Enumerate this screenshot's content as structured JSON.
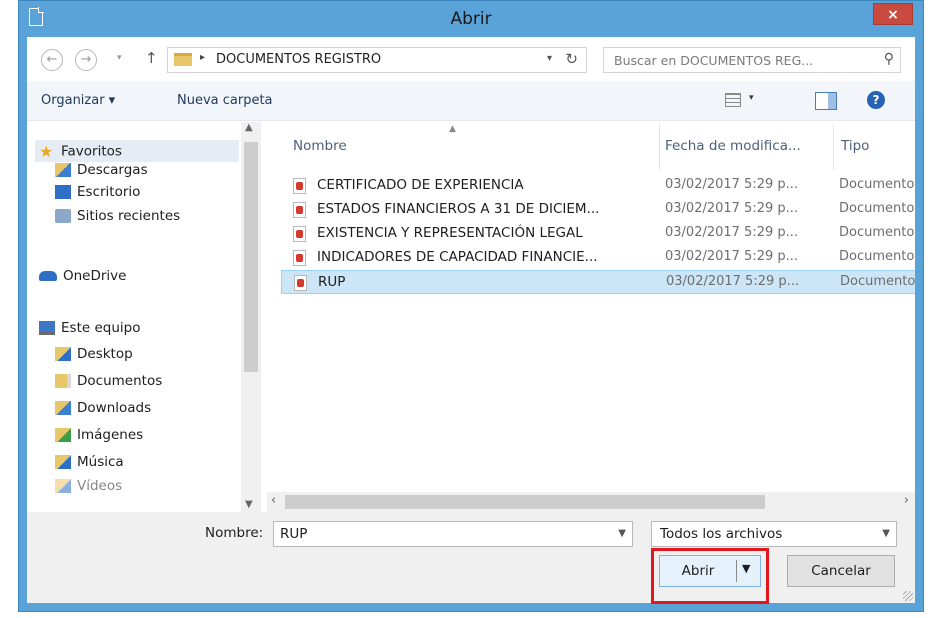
{
  "window": {
    "title": "Abrir",
    "close_label": "×"
  },
  "address": {
    "path": "DOCUMENTOS REGISTRO",
    "search_placeholder": "Buscar en DOCUMENTOS REG...",
    "icons": {
      "back": "back-arrow-icon",
      "forward": "forward-arrow-icon",
      "up": "up-arrow-icon",
      "refresh": "refresh-icon",
      "search": "search-icon"
    }
  },
  "toolbar": {
    "organize_label": "Organizar ▾",
    "new_folder_label": "Nueva carpeta"
  },
  "nav": {
    "favorites": "Favoritos",
    "downloads": "Descargas",
    "desktop_es": "Escritorio",
    "recent": "Sitios recientes",
    "onedrive": "OneDrive",
    "this_pc": "Este equipo",
    "desktop": "Desktop",
    "documents": "Documentos",
    "downloads_en": "Downloads",
    "pictures": "Imágenes",
    "music": "Música",
    "videos": "Vídeos"
  },
  "columns": {
    "name": "Nombre",
    "date": "Fecha de modifica...",
    "type": "Tipo"
  },
  "files": [
    {
      "name": "CERTIFICADO DE EXPERIENCIA",
      "date": "03/02/2017 5:29 p...",
      "type": "Documento"
    },
    {
      "name": "ESTADOS FINANCIEROS A 31 DE DICIEM...",
      "date": "03/02/2017 5:29 p...",
      "type": "Documento"
    },
    {
      "name": "EXISTENCIA Y REPRESENTACIÓN LEGAL",
      "date": "03/02/2017 5:29 p...",
      "type": "Documento"
    },
    {
      "name": "INDICADORES DE CAPACIDAD FINANCIE...",
      "date": "03/02/2017 5:29 p...",
      "type": "Documento"
    },
    {
      "name": "RUP",
      "date": "03/02/2017 5:29 p...",
      "type": "Documento"
    }
  ],
  "bottom": {
    "name_label": "Nombre:",
    "name_value": "RUP",
    "filter_value": "Todos los archivos",
    "open_label": "Abrir",
    "cancel_label": "Cancelar"
  },
  "colors": {
    "frame": "#5aa3d8",
    "close": "#c94b40",
    "selection": "#cde6f7",
    "highlight": "#e2161d"
  }
}
